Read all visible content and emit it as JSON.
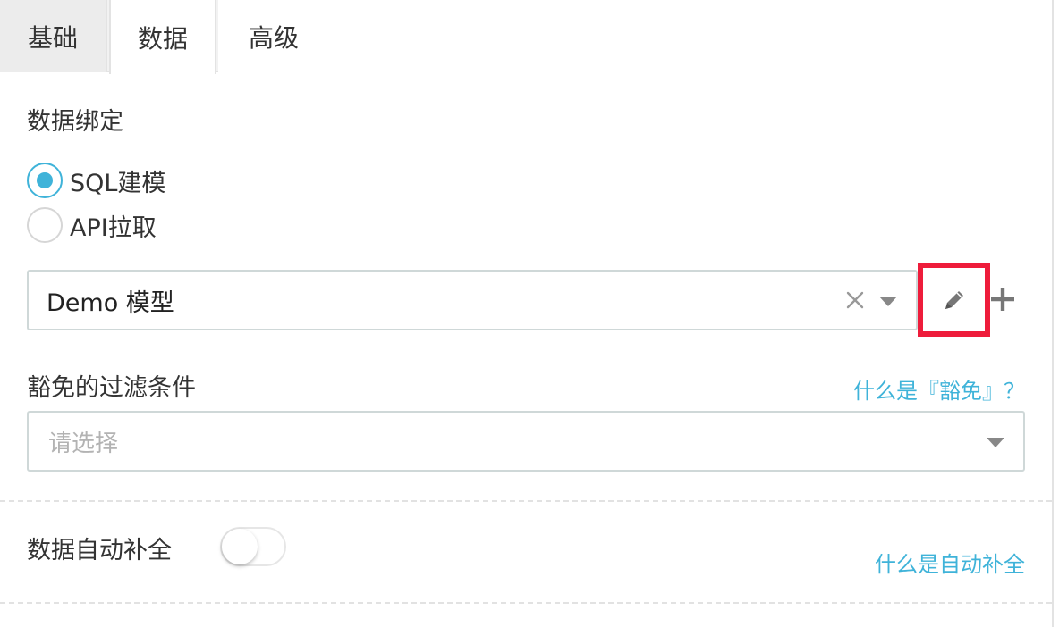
{
  "tabs": [
    {
      "label": "基础",
      "active": false
    },
    {
      "label": "数据",
      "active": true
    },
    {
      "label": "高级",
      "active": false
    }
  ],
  "section_title": "数据绑定",
  "binding_options": [
    {
      "label": "SQL建模",
      "checked": true
    },
    {
      "label": "API拉取",
      "checked": false
    }
  ],
  "model_select": {
    "value": "Demo 模型"
  },
  "filter": {
    "label": "豁免的过滤条件",
    "help_link": "什么是『豁免』？",
    "placeholder": "请选择"
  },
  "auto_complete": {
    "label": "数据自动补全",
    "enabled": false,
    "help_link": "什么是自动补全"
  },
  "colors": {
    "accent": "#3fb3d9",
    "highlight_border": "#ee1c3b"
  },
  "icons": [
    "clear-icon",
    "caret-down-icon",
    "pencil-icon",
    "plus-icon"
  ]
}
